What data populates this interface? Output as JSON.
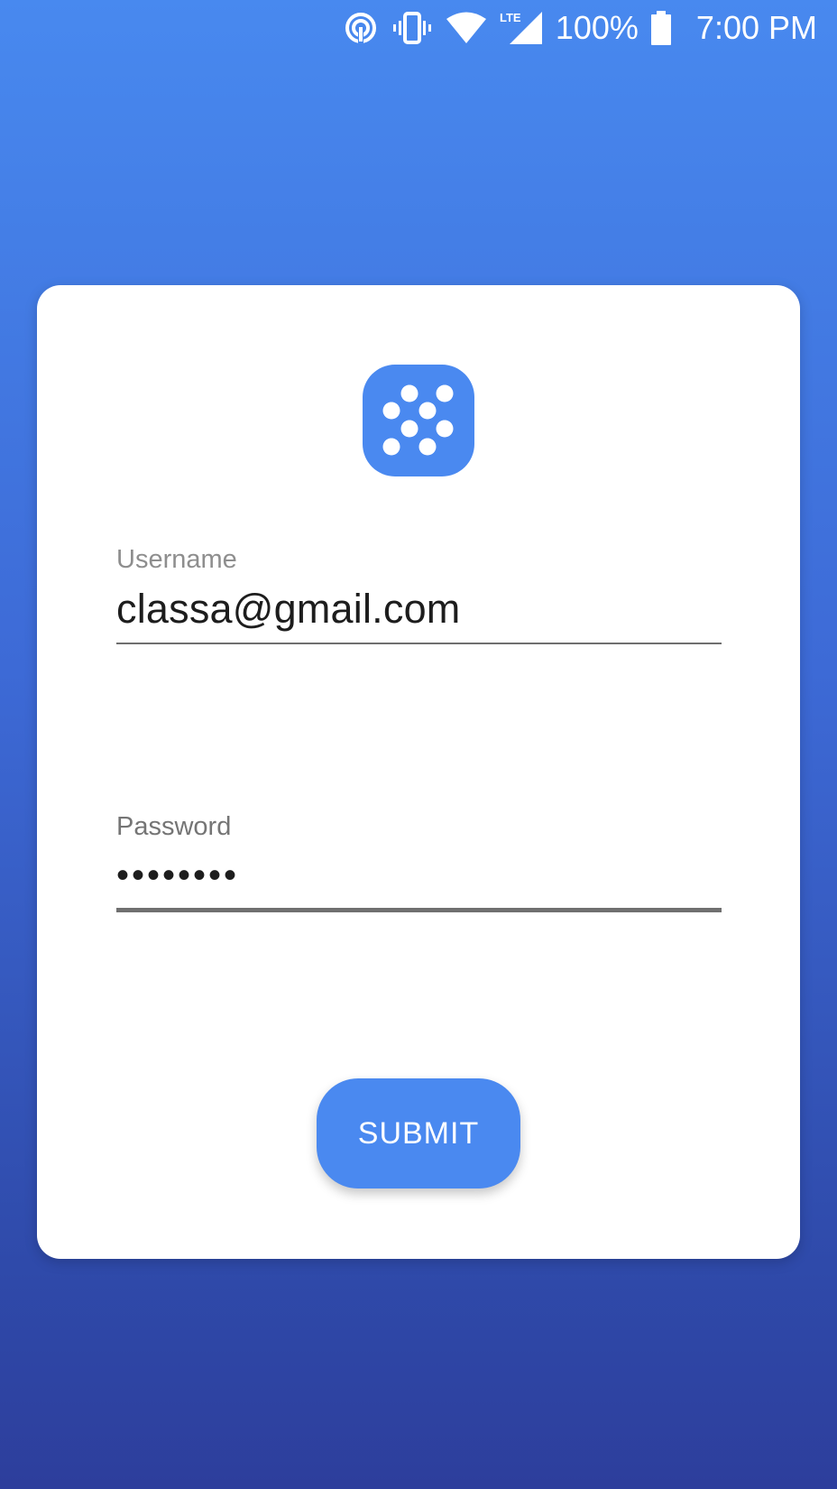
{
  "status_bar": {
    "battery_percent": "100%",
    "time": "7:00 PM",
    "network_label": "LTE",
    "icons": [
      "hotspot-icon",
      "vibrate-icon",
      "wifi-icon",
      "lte-signal-icon",
      "battery-icon"
    ]
  },
  "app": {
    "logo_icon": "app-logo-dots-icon",
    "brand_color": "#4a89f0"
  },
  "form": {
    "username": {
      "label": "Username",
      "value": "classa@gmail.com"
    },
    "password": {
      "label": "Password",
      "value": "••••••••"
    },
    "submit_label": "SUBMIT"
  },
  "colors": {
    "background_top": "#4889ef",
    "background_bottom": "#2d3e9c",
    "card": "#ffffff",
    "accent": "#4a89f0"
  }
}
